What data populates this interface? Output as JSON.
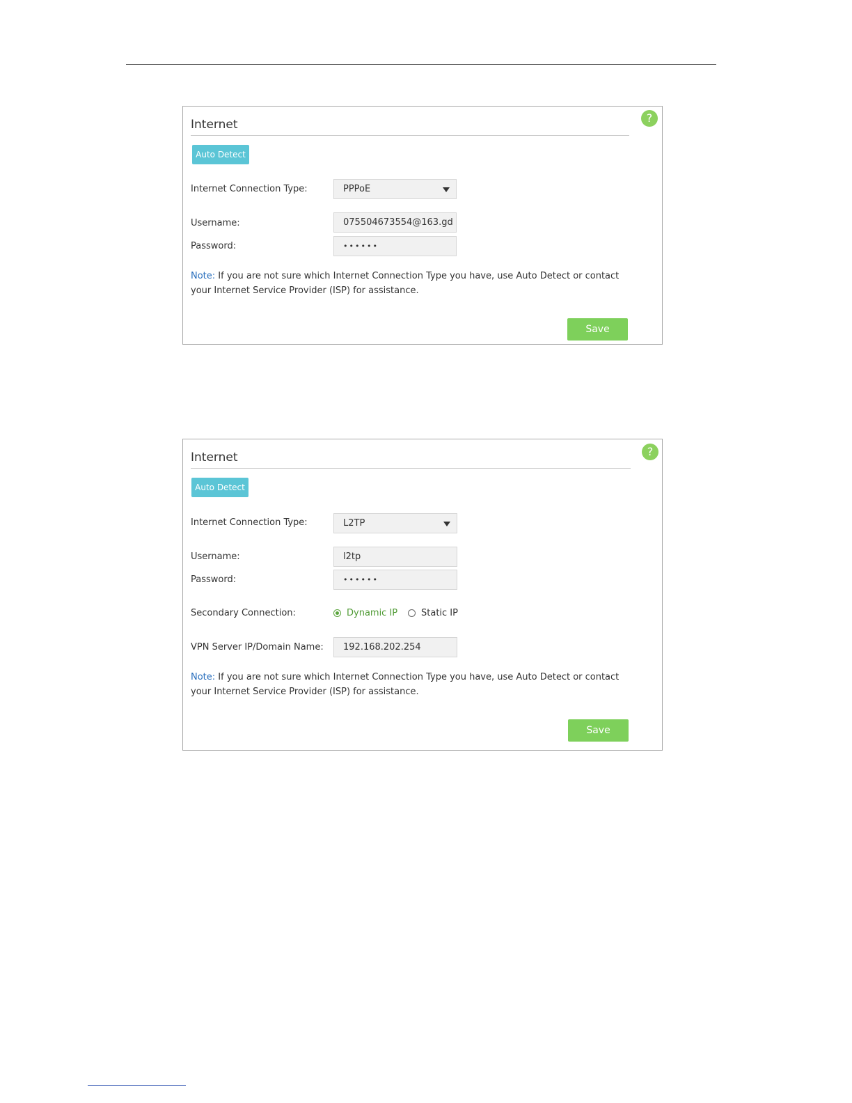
{
  "panels": [
    {
      "title": "Internet",
      "help_label": "?",
      "auto_detect_label": "Auto Detect",
      "connection_type_label": "Internet Connection Type:",
      "connection_type_value": "PPPoE",
      "username_label": "Username:",
      "username_value": "075504673554@163.gd",
      "password_label": "Password:",
      "password_value": "••••••",
      "note_label": "Note:",
      "note_text": "If you are not sure which Internet Connection Type you have, use Auto Detect or contact your Internet Service Provider (ISP) for assistance.",
      "save_label": "Save"
    },
    {
      "title": "Internet",
      "help_label": "?",
      "auto_detect_label": "Auto Detect",
      "connection_type_label": "Internet Connection Type:",
      "connection_type_value": "L2TP",
      "username_label": "Username:",
      "username_value": "l2tp",
      "password_label": "Password:",
      "password_value": "••••••",
      "secondary_label": "Secondary Connection:",
      "secondary_options": [
        "Dynamic IP",
        "Static IP"
      ],
      "secondary_selected": "Dynamic IP",
      "vpn_label": "VPN Server IP/Domain Name:",
      "vpn_value": "192.168.202.254",
      "note_label": "Note:",
      "note_text": "If you are not sure which Internet Connection Type you have, use Auto Detect or contact your Internet Service Provider (ISP) for assistance.",
      "save_label": "Save"
    }
  ],
  "colors": {
    "accent_blue": "#5bc5d6",
    "save_green": "#7ed05b",
    "help_green": "#8cd15e",
    "note_blue": "#2a6fbd"
  }
}
